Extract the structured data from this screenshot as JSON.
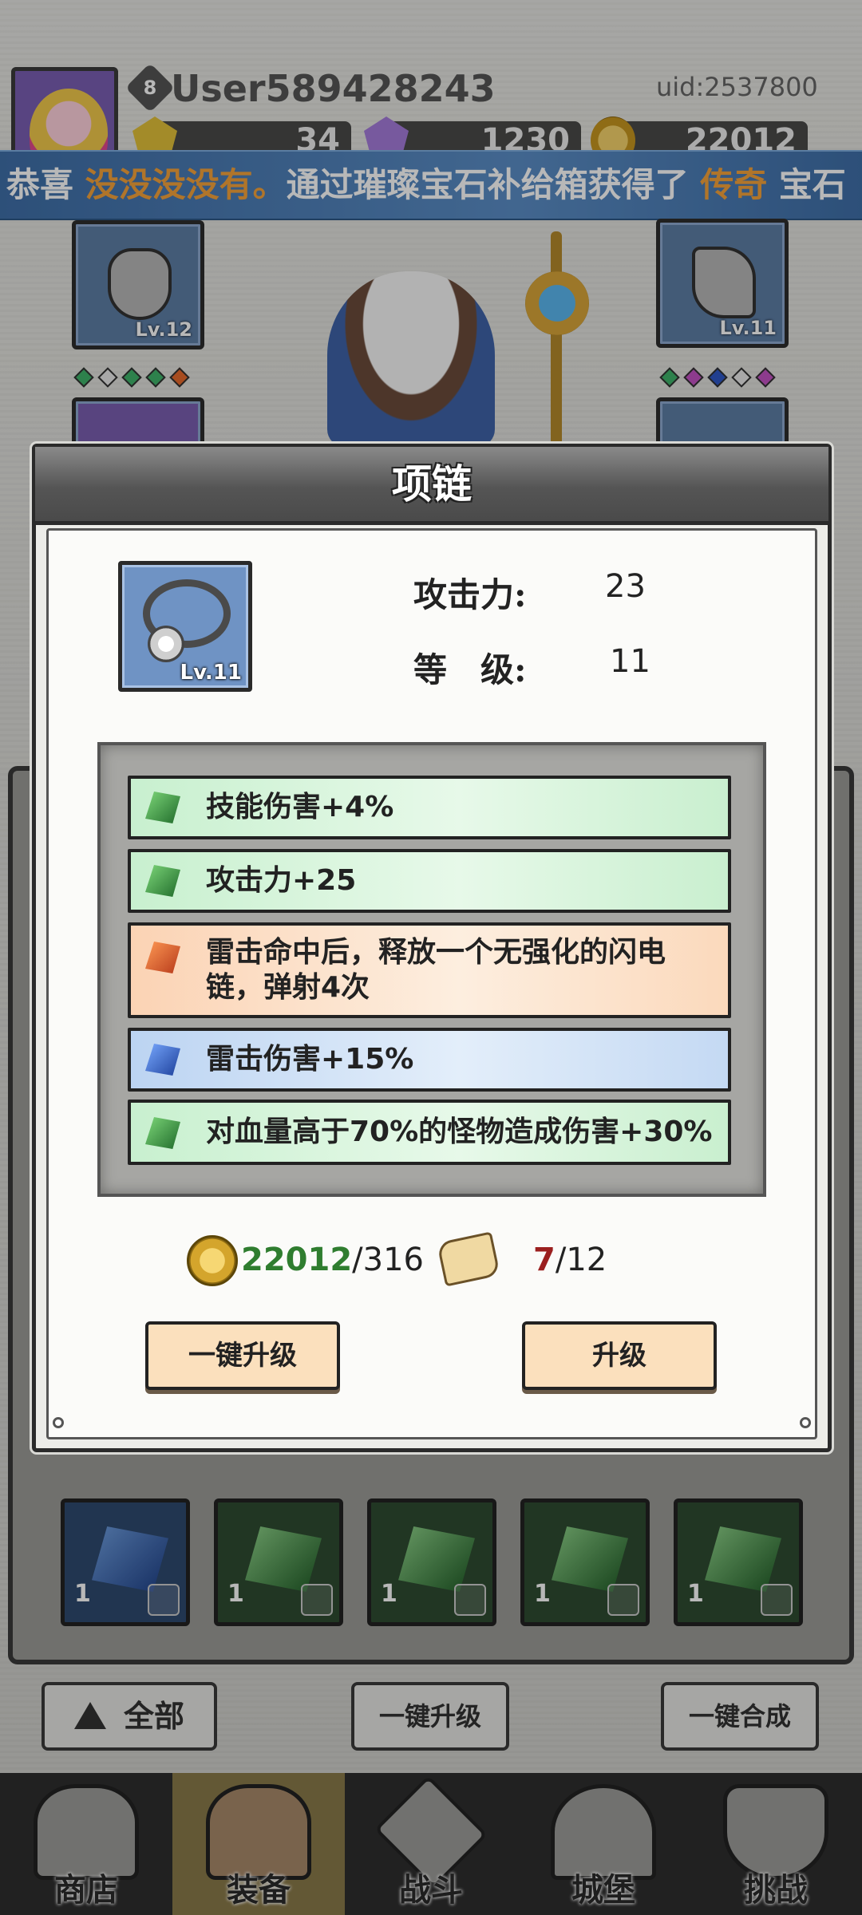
{
  "header": {
    "level": "8",
    "username": "User589428243",
    "uid": "uid:2537800",
    "resources": [
      "34",
      "1230",
      "22012"
    ]
  },
  "ticker": {
    "prefix": "恭喜 ",
    "player": "没没没没有。",
    "middle": "通过璀璨宝石补给箱获得了 ",
    "rarity": "传奇",
    "suffix": " 宝石"
  },
  "equipment": {
    "left_slot_level": "Lv.12",
    "right_slot_level": "Lv.11"
  },
  "dialog": {
    "title": "项链",
    "item_level": "Lv.11",
    "stats": [
      {
        "label": "攻击力:",
        "value": "23"
      },
      {
        "label": "等　级:",
        "value": "11"
      }
    ],
    "affixes": [
      {
        "text": "技能伤害+4%",
        "color": "green"
      },
      {
        "text": "攻击力+25",
        "color": "green"
      },
      {
        "text": "雷击命中后，释放一个无强化的闪电链，弹射4次",
        "color": "orange"
      },
      {
        "text": "雷击伤害+15%",
        "color": "blue"
      },
      {
        "text": "对血量高于70%的怪物造成伤害+30%",
        "color": "green"
      }
    ],
    "costs": {
      "gold_have": "22012",
      "gold_need": "/316",
      "scroll_have": "7",
      "scroll_need": "/12"
    },
    "buttons": {
      "upgrade_all": "一键升级",
      "upgrade": "升级"
    }
  },
  "inventory": {
    "counts": [
      "1",
      "1",
      "1",
      "1",
      "1"
    ]
  },
  "bottom_buttons": {
    "filter_all": "全部",
    "upgrade_all": "一键升级",
    "merge_all": "一键合成"
  },
  "nav": [
    {
      "label": "商店",
      "icon": "shop-hut-icon"
    },
    {
      "label": "装备",
      "icon": "backpack-icon",
      "active": true
    },
    {
      "label": "战斗",
      "icon": "crossed-swords-icon"
    },
    {
      "label": "城堡",
      "icon": "castle-icon"
    },
    {
      "label": "挑战",
      "icon": "locked-shield-icon"
    }
  ],
  "colors": {
    "ticker_bg": "#4f80bb",
    "ticker_highlight": "#f4a23b",
    "gold_have": "#2f7d2f",
    "scroll_have": "#9b1f1f",
    "button_bg": "#fbe0bd"
  }
}
